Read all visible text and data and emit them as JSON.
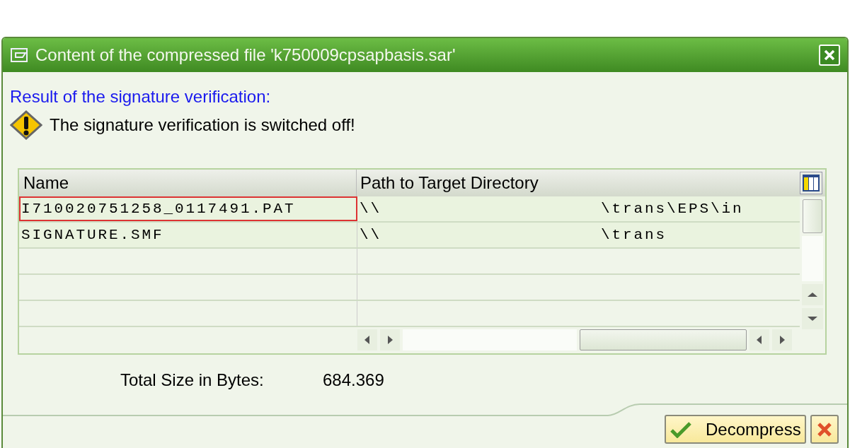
{
  "window": {
    "title": "Content of the compressed file 'k750009cpsapbasis.sar'"
  },
  "result_heading": "Result of the signature verification:",
  "message": "The signature verification is switched off!",
  "table": {
    "columns": [
      "Name",
      "Path to Target Directory"
    ],
    "rows": [
      {
        "name": "I710020751258_0117491.PAT",
        "path": "\\\\                    \\trans\\EPS\\in",
        "focused": true
      },
      {
        "name": "SIGNATURE.SMF",
        "path": "\\\\                    \\trans",
        "focused": false
      }
    ]
  },
  "total": {
    "label": "Total Size in Bytes:",
    "value": "684.369"
  },
  "buttons": {
    "confirm": "Decompress"
  }
}
